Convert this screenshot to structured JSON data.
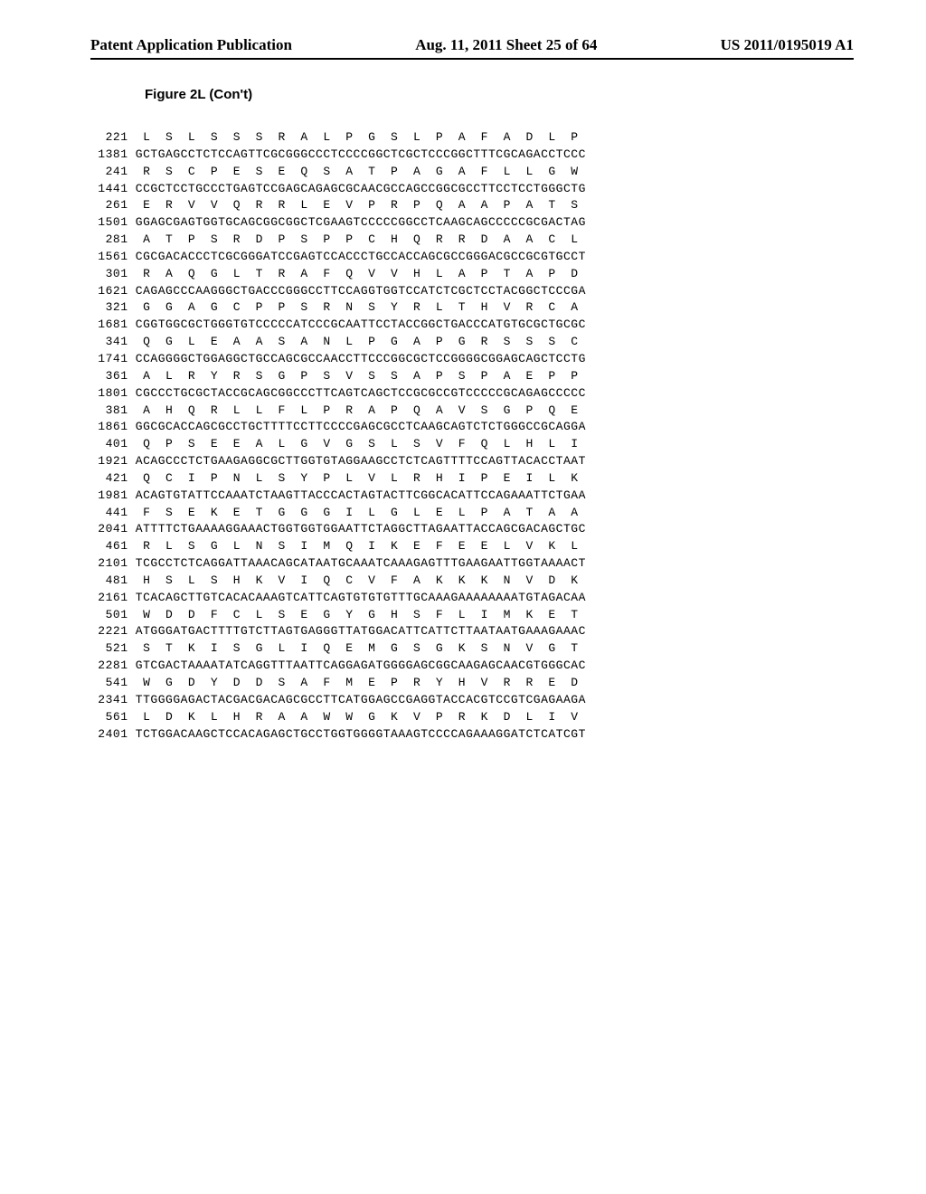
{
  "header": {
    "left": "Patent Application Publication",
    "center": "Aug. 11, 2011  Sheet 25 of 64",
    "right": "US 2011/0195019 A1"
  },
  "figure_title": "Figure 2L (Con't)",
  "sequence": [
    {
      "pos_aa": "221",
      "aa": "L  S  L  S  S  S  R  A  L  P  G  S  L  P  A  F  A  D  L  P",
      "pos_nt": "1381",
      "nt": "GCTGAGCCTCTCCAGTTCGCGGGCCCTCCCCGGCTCGCTCCCGGCTTTCGCAGACCTCCC"
    },
    {
      "pos_aa": "241",
      "aa": "R  S  C  P  E  S  E  Q  S  A  T  P  A  G  A  F  L  L  G  W",
      "pos_nt": "1441",
      "nt": "CCGCTCCTGCCCTGAGTCCGAGCAGAGCGCAACGCCAGCCGGCGCCTTCCTCCTGGGCTG"
    },
    {
      "pos_aa": "261",
      "aa": "E  R  V  V  Q  R  R  L  E  V  P  R  P  Q  A  A  P  A  T  S",
      "pos_nt": "1501",
      "nt": "GGAGCGAGTGGTGCAGCGGCGGCTCGAAGTCCCCCGGCCTCAAGCAGCCCCCGCGACTAG"
    },
    {
      "pos_aa": "281",
      "aa": "A  T  P  S  R  D  P  S  P  P  C  H  Q  R  R  D  A  A  C  L",
      "pos_nt": "1561",
      "nt": "CGCGACACCCTCGCGGGATCCGAGTCCACCCTGCCACCAGCGCCGGGACGCCGCGTGCCT"
    },
    {
      "pos_aa": "301",
      "aa": "R  A  Q  G  L  T  R  A  F  Q  V  V  H  L  A  P  T  A  P  D",
      "pos_nt": "1621",
      "nt": "CAGAGCCCAAGGGCTGACCCGGGCCTTCCAGGTGGTCCATCTCGCTCCTACGGCTCCCGA"
    },
    {
      "pos_aa": "321",
      "aa": "G  G  A  G  C  P  P  S  R  N  S  Y  R  L  T  H  V  R  C  A",
      "pos_nt": "1681",
      "nt": "CGGTGGCGCTGGGTGTCCCCCATCCCGCAATTCCTACCGGCTGACCCATGTGCGCTGCGC"
    },
    {
      "pos_aa": "341",
      "aa": "Q  G  L  E  A  A  S  A  N  L  P  G  A  P  G  R  S  S  S  C",
      "pos_nt": "1741",
      "nt": "CCAGGGGCTGGAGGCTGCCAGCGCCAACCTTCCCGGCGCTCCGGGGCGGAGCAGCTCCTG"
    },
    {
      "pos_aa": "361",
      "aa": "A  L  R  Y  R  S  G  P  S  V  S  S  A  P  S  P  A  E  P  P",
      "pos_nt": "1801",
      "nt": "CGCCCTGCGCTACCGCAGCGGCCCTTCAGTCAGCTCCGCGCCGTCCCCCGCAGAGCCCCC"
    },
    {
      "pos_aa": "381",
      "aa": "A  H  Q  R  L  L  F  L  P  R  A  P  Q  A  V  S  G  P  Q  E",
      "pos_nt": "1861",
      "nt": "GGCGCACCAGCGCCTGCTTTTCCTTCCCCGAGCGCCTCAAGCAGTCTCTGGGCCGCAGGA"
    },
    {
      "pos_aa": "401",
      "aa": "Q  P  S  E  E  A  L  G  V  G  S  L  S  V  F  Q  L  H  L  I",
      "pos_nt": "1921",
      "nt": "ACAGCCCTCTGAAGAGGCGCTTGGTGTAGGAAGCCTCTCAGTTTTCCAGTTACACCTAAT"
    },
    {
      "pos_aa": "421",
      "aa": "Q  C  I  P  N  L  S  Y  P  L  V  L  R  H  I  P  E  I  L  K",
      "pos_nt": "1981",
      "nt": "ACAGTGTATTCCAAATCTAAGTTACCCACTAGTACTTCGGCACATTCCAGAAATTCTGAA"
    },
    {
      "pos_aa": "441",
      "aa": "F  S  E  K  E  T  G  G  G  I  L  G  L  E  L  P  A  T  A  A",
      "pos_nt": "2041",
      "nt": "ATTTTCTGAAAAGGAAACTGGTGGTGGAATTCTAGGCTTAGAATTACCAGCGACAGCTGC"
    },
    {
      "pos_aa": "461",
      "aa": "R  L  S  G  L  N  S  I  M  Q  I  K  E  F  E  E  L  V  K  L",
      "pos_nt": "2101",
      "nt": "TCGCCTCTCAGGATTAAACAGCATAATGCAAATCAAAGAGTTTGAAGAATTGGTAAAACT"
    },
    {
      "pos_aa": "481",
      "aa": "H  S  L  S  H  K  V  I  Q  C  V  F  A  K  K  K  N  V  D  K",
      "pos_nt": "2161",
      "nt": "TCACAGCTTGTCACACAAAGTCATTCAGTGTGTGTTTGCAAAGAAAAAAAATGTAGACAA"
    },
    {
      "pos_aa": "501",
      "aa": "W  D  D  F  C  L  S  E  G  Y  G  H  S  F  L  I  M  K  E  T",
      "pos_nt": "2221",
      "nt": "ATGGGATGACTTTTGTCTTAGTGAGGGTTATGGACATTCATTCTTAATAATGAAAGAAAC"
    },
    {
      "pos_aa": "521",
      "aa": "S  T  K  I  S  G  L  I  Q  E  M  G  S  G  K  S  N  V  G  T",
      "pos_nt": "2281",
      "nt": "GTCGACTAAAATATCAGGTTTAATTCAGGAGATGGGGAGCGGCAAGAGCAACGTGGGCAC"
    },
    {
      "pos_aa": "541",
      "aa": "W  G  D  Y  D  D  S  A  F  M  E  P  R  Y  H  V  R  R  E  D",
      "pos_nt": "2341",
      "nt": "TTGGGGAGACTACGACGACAGCGCCTTCATGGAGCCGAGGTACCACGTCCGTCGAGAAGA"
    },
    {
      "pos_aa": "561",
      "aa": "L  D  K  L  H  R  A  A  W  W  G  K  V  P  R  K  D  L  I  V",
      "pos_nt": "2401",
      "nt": "TCTGGACAAGCTCCACAGAGCTGCCTGGTGGGGTAAAGTCCCCAGAAAGGATCTCATCGT"
    }
  ]
}
